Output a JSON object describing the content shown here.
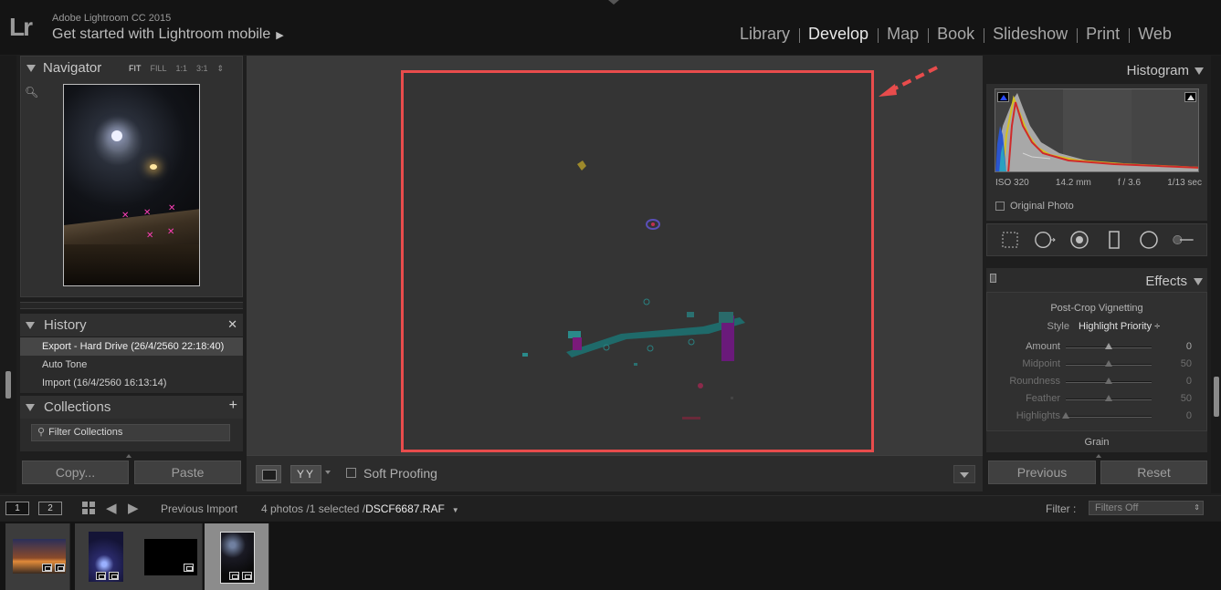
{
  "app": {
    "logo": "Lr",
    "title": "Adobe Lightroom CC 2015",
    "mobile_link": "Get started with Lightroom mobile",
    "modules": [
      "Library",
      "Develop",
      "Map",
      "Book",
      "Slideshow",
      "Print",
      "Web"
    ],
    "active_module": "Develop"
  },
  "left_panel": {
    "navigator": {
      "title": "Navigator",
      "zoom_options": [
        "FIT",
        "FILL",
        "1:1",
        "3:1"
      ],
      "active_zoom": "FIT"
    },
    "history": {
      "title": "History",
      "close": "✕",
      "items": [
        "Export - Hard Drive (26/4/2560 22:18:40)",
        "Auto Tone",
        "Import (16/4/2560 16:13:14)"
      ],
      "selected_index": 0
    },
    "collections": {
      "title": "Collections",
      "add": "+",
      "filter_placeholder": "Filter Collections"
    },
    "buttons": {
      "copy": "Copy...",
      "paste": "Paste"
    }
  },
  "toolbar": {
    "view_compare": "YY",
    "soft_proofing_label": "Soft Proofing",
    "soft_proofing_checked": false
  },
  "right_panel": {
    "histogram": {
      "title": "Histogram",
      "exif": [
        "ISO 320",
        "14.2 mm",
        "f / 3.6",
        "1/13 sec"
      ],
      "original_photo": "Original Photo"
    },
    "effects": {
      "title": "Effects",
      "post_crop_title": "Post-Crop Vignetting",
      "style_label": "Style",
      "style_value": "Highlight Priority ÷",
      "sliders": [
        {
          "label": "Amount",
          "value": "0",
          "position": 0.5,
          "enabled": true
        },
        {
          "label": "Midpoint",
          "value": "50",
          "position": 0.5,
          "enabled": false
        },
        {
          "label": "Roundness",
          "value": "0",
          "position": 0.5,
          "enabled": false
        },
        {
          "label": "Feather",
          "value": "50",
          "position": 0.5,
          "enabled": false
        },
        {
          "label": "Highlights",
          "value": "0",
          "position": 0.0,
          "enabled": false
        }
      ],
      "grain_title": "Grain"
    },
    "buttons": {
      "previous": "Previous",
      "reset": "Reset"
    }
  },
  "filmstrip_bar": {
    "monitor1": "1",
    "monitor2": "2",
    "source": "Previous Import",
    "count": "4 photos /1 selected /",
    "filename": "DSCF6687.RAF",
    "filter_label": "Filter :",
    "filter_value": "Filters Off"
  },
  "filmstrip": {
    "selected_index": 3
  },
  "colors": {
    "accent_highlight_box": "#e84c4c",
    "panel_bg": "#262626",
    "center_bg": "#3a3a3a",
    "topbar_bg": "#141414"
  }
}
